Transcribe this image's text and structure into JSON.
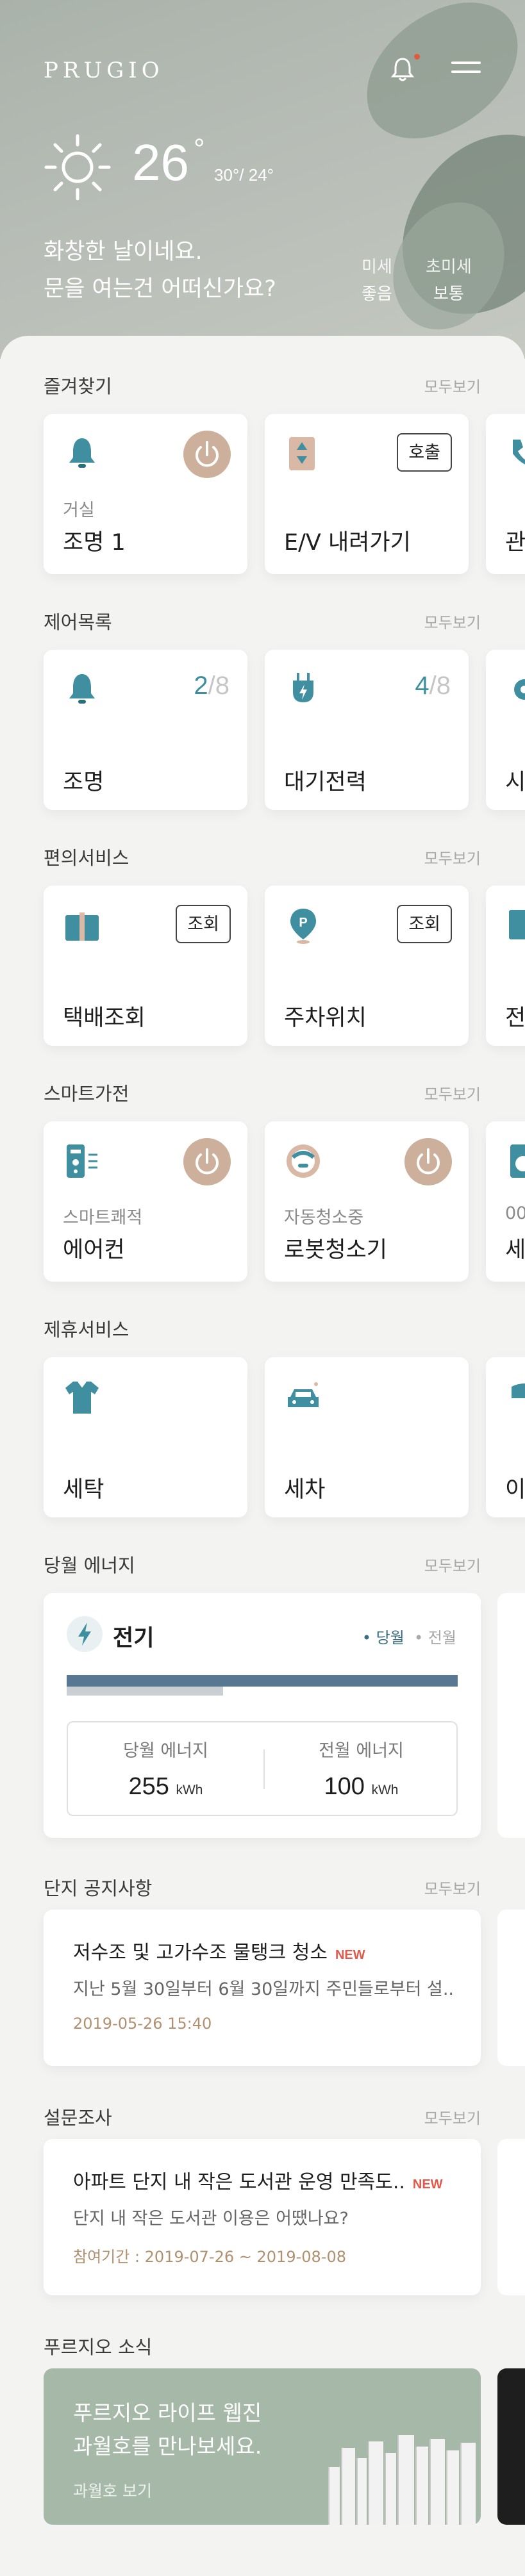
{
  "header": {
    "logo": "PRUGIO",
    "weather": {
      "temp": "26",
      "deg": "°",
      "range": "30°/ 24°",
      "icon": "sun-icon"
    },
    "greeting": [
      "화창한 날이네요.",
      "문을 여는건 어떠신가요?"
    ],
    "dust": [
      {
        "label": "미세",
        "value": "좋음"
      },
      {
        "label": "초미세",
        "value": "보통"
      }
    ]
  },
  "more_label": "모두보기",
  "favorites": {
    "title": "즐겨찾기",
    "cards": [
      {
        "sub": "거실",
        "title": "조명 1",
        "icon": "bell-lamp-icon"
      },
      {
        "title": "E/V 내려가기",
        "button": "호출",
        "icon": "elevator-icon"
      },
      {
        "title": "관",
        "icon": "phone-icon"
      }
    ]
  },
  "controls": {
    "title": "제어목록",
    "cards": [
      {
        "title": "조명",
        "count": "2",
        "total": "/8",
        "icon": "bell-lamp-icon"
      },
      {
        "title": "대기전력",
        "count": "4",
        "total": "/8",
        "icon": "plug-icon"
      },
      {
        "title": "시",
        "icon": "gear-icon"
      }
    ]
  },
  "services": {
    "title": "편의서비스",
    "cards": [
      {
        "title": "택배조회",
        "button": "조회",
        "icon": "parcel-icon"
      },
      {
        "title": "주차위치",
        "button": "조회",
        "icon": "parking-pin-icon"
      },
      {
        "title": "전",
        "icon": "board-icon"
      }
    ]
  },
  "appliances": {
    "title": "스마트가전",
    "cards": [
      {
        "sub": "스마트쾌적",
        "title": "에어컨",
        "icon": "aircon-icon"
      },
      {
        "sub": "자동청소중",
        "title": "로봇청소기",
        "icon": "robot-cleaner-icon"
      },
      {
        "sub": "00",
        "title": "세",
        "icon": "washer-icon"
      }
    ]
  },
  "partners": {
    "title": "제휴서비스",
    "cards": [
      {
        "title": "세탁",
        "icon": "shirt-icon"
      },
      {
        "title": "세차",
        "icon": "car-icon"
      },
      {
        "title": "이",
        "icon": "truck-icon"
      }
    ]
  },
  "energy": {
    "title": "당월 에너지",
    "card_title": "전기",
    "legend_current": "• 당월",
    "legend_prev": "• 전월",
    "current_label": "당월 에너지",
    "current_value": "255",
    "prev_label": "전월 에너지",
    "prev_value": "100",
    "unit": "kWh",
    "current_fill": 1.0,
    "prev_fill": 0.4
  },
  "notice": {
    "title": "단지 공지사항",
    "item_title": "저수조 및 고가수조 물탱크 청소",
    "badge": "NEW",
    "body": "지난 5월 30일부터 6월 30일까지 주민들로부터 설..",
    "date": "2019-05-26 15:40"
  },
  "survey": {
    "title": "설문조사",
    "item_title": "아파트 단지 내 작은 도서관 운영 만족도..",
    "badge": "NEW",
    "body": "단지 내 작은 도서관 이용은 어땠나요?",
    "date": "참여기간 : 2019-07-26 ~ 2019-08-08"
  },
  "news": {
    "title": "푸르지오 소식",
    "banner_line1": "푸르지오 라이프 웹진",
    "banner_line2": "과월호를 만나보세요.",
    "banner_link": "과월호 보기"
  },
  "colors": {
    "accent": "#3f8fa0",
    "power": "#cdb09b",
    "new": "#e2584a",
    "energy_bar": "#577890"
  }
}
